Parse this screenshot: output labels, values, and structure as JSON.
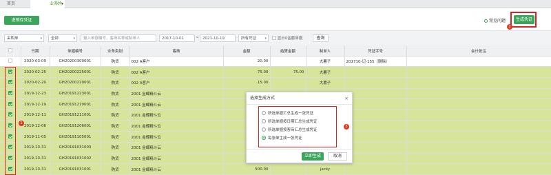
{
  "tabs": {
    "home": "首页",
    "active": "业务凭证",
    "close": "×",
    "dropdown": "▾"
  },
  "toolbar": {
    "generate_voucher_label": "进销存凭证",
    "help_label": "常见问题",
    "generate_btn_label": "生成凭证"
  },
  "filters": {
    "type": "采购单",
    "scope": "全部",
    "search_placeholder": "输入单据编号、客商名称或制单人",
    "date_from": "2017-10-01",
    "date_sep": "~",
    "date_to": "2021-10-19",
    "voucher_filter": "所有凭证",
    "show_zero_label": "显示0金额单据",
    "query_label": "查询"
  },
  "table": {
    "headers": [
      "日期",
      "单据编号",
      "业务类别",
      "客商",
      "金额",
      "结算金额",
      "制单人",
      "凭证字号",
      "会计批注"
    ],
    "rows": [
      {
        "checked": false,
        "date": "2020-03-09",
        "no": "GH20200309001",
        "cat": "购货",
        "party": "002 A客户",
        "amount": "20.00",
        "settle": "",
        "maker": "大薯子",
        "voucher": "201710-记-155（删除）",
        "note": ""
      },
      {
        "checked": true,
        "date": "2020-02-25",
        "no": "GH20200225001",
        "cat": "购货",
        "party": "002 A客户",
        "amount": "75.00",
        "settle": "75.00",
        "maker": "大薯子",
        "voucher": "",
        "note": ""
      },
      {
        "checked": true,
        "date": "2020-02-20",
        "no": "GH20200220001",
        "cat": "购货",
        "party": "002 A客户",
        "amount": "15.00",
        "settle": "",
        "maker": "大薯子",
        "voucher": "",
        "note": ""
      },
      {
        "checked": true,
        "date": "2019-12-23",
        "no": "GH20191223001",
        "cat": "购货",
        "party": "2001 金蝶精斗云",
        "amount": "",
        "settle": "",
        "maker": "",
        "voucher": "",
        "note": ""
      },
      {
        "checked": true,
        "date": "2019-12-19",
        "no": "GH20191219001",
        "cat": "购货",
        "party": "2001 金蝶精斗云",
        "amount": "",
        "settle": "",
        "maker": "",
        "voucher": "",
        "note": ""
      },
      {
        "checked": true,
        "date": "2019-12-11",
        "no": "GH20191211001",
        "cat": "购货",
        "party": "2001 金蝶精斗云",
        "amount": "",
        "settle": "",
        "maker": "",
        "voucher": "",
        "note": ""
      },
      {
        "checked": true,
        "date": "2019-12-06",
        "no": "GH20191206001",
        "cat": "购货",
        "party": "2001 金蝶精斗云",
        "amount": "",
        "settle": "",
        "maker": "",
        "voucher": "",
        "note": ""
      },
      {
        "checked": true,
        "date": "2019-11-05",
        "no": "GH20191105001",
        "cat": "购货",
        "party": "2001 金蝶精斗云",
        "amount": "",
        "settle": "",
        "maker": "",
        "voucher": "",
        "note": ""
      },
      {
        "checked": true,
        "date": "2019-10-31",
        "no": "GH20191031003",
        "cat": "购货",
        "party": "2001 金蝶精斗云",
        "amount": "",
        "settle": "",
        "maker": "",
        "voucher": "",
        "note": ""
      },
      {
        "checked": true,
        "date": "2019-10-31",
        "no": "GH20191031002",
        "cat": "购货",
        "party": "2001 金蝶精斗云",
        "amount": "",
        "settle": "",
        "maker": "",
        "voucher": "",
        "note": ""
      },
      {
        "checked": true,
        "date": "2019-10-31",
        "no": "GH20191031001",
        "cat": "购货",
        "party": "2001 金蝶精斗云",
        "amount": "500.00",
        "settle": "",
        "maker": "jacky",
        "voucher": "",
        "note": ""
      }
    ]
  },
  "modal": {
    "title": "选择生成方式",
    "close": "×",
    "options": [
      {
        "label": "所选单据汇总生成一张凭证",
        "selected": false
      },
      {
        "label": "所选单据按日期汇总生成凭证",
        "selected": false
      },
      {
        "label": "所选单据按客商汇总生成凭证",
        "selected": false
      },
      {
        "label": "每张单生成一张凭证",
        "selected": true
      }
    ],
    "ok_label": "立即生成",
    "cancel_label": "取消"
  },
  "annotations": {
    "a1": "1",
    "a2": "2",
    "a3": "3"
  }
}
